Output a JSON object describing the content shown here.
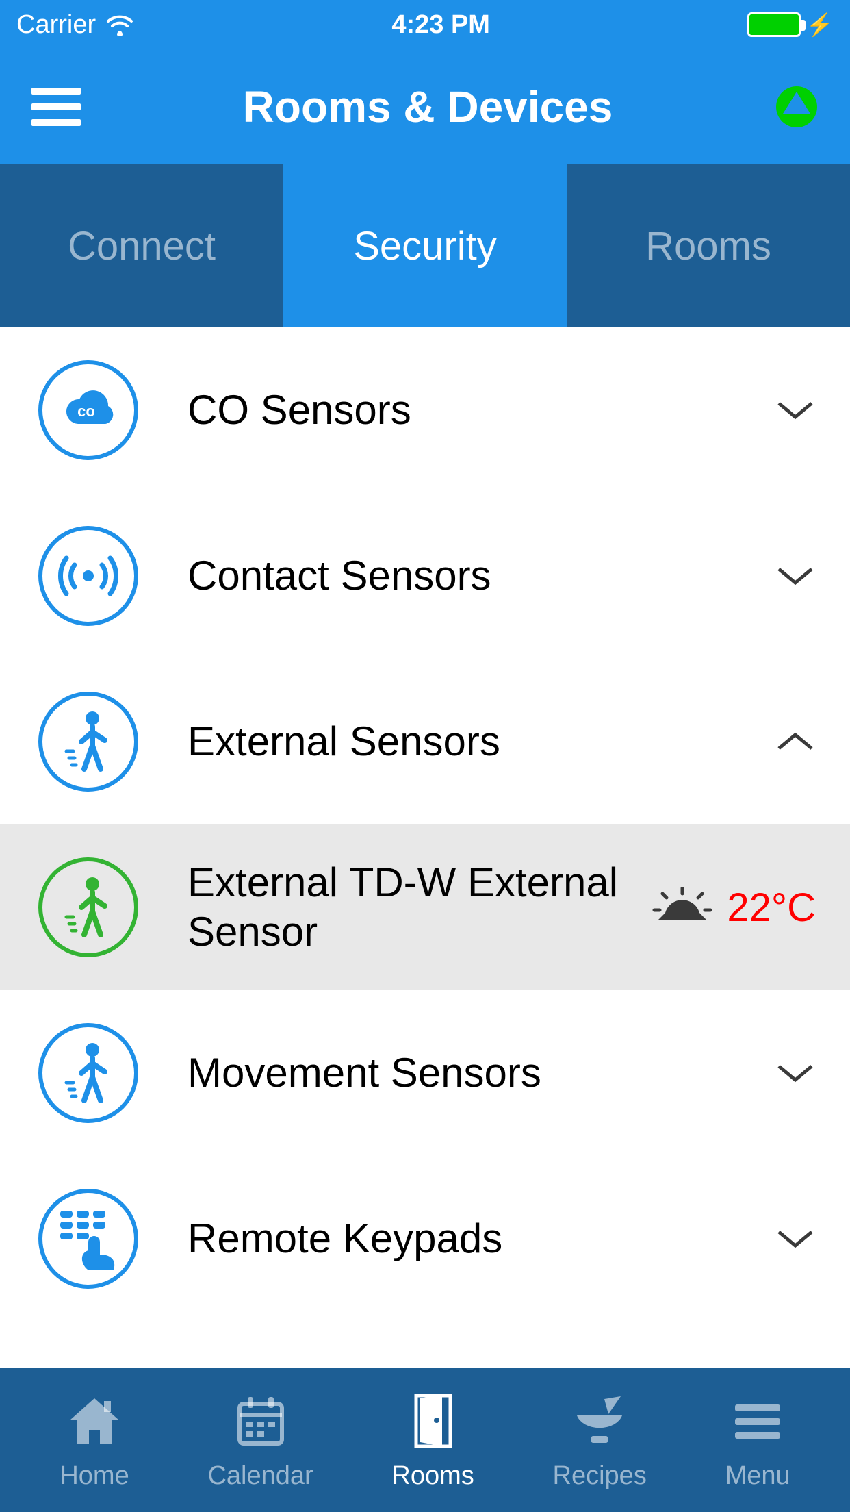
{
  "status": {
    "carrier": "Carrier",
    "time": "4:23 PM"
  },
  "header": {
    "title": "Rooms & Devices"
  },
  "tabs": {
    "items": [
      "Connect",
      "Security",
      "Rooms"
    ],
    "active_index": 1
  },
  "list": {
    "items": [
      {
        "icon": "co-cloud-icon",
        "label": "CO Sensors",
        "expanded": false
      },
      {
        "icon": "contact-radio-icon",
        "label": "Contact Sensors",
        "expanded": false
      },
      {
        "icon": "motion-person-icon",
        "label": "External Sensors",
        "expanded": true
      },
      {
        "icon": "motion-person-icon",
        "icon_color": "green",
        "label": "External TD-W External Sensor",
        "sub": true,
        "value": "22°C",
        "value_icon": "weather-icon"
      },
      {
        "icon": "motion-person-icon",
        "label": "Movement Sensors",
        "expanded": false
      },
      {
        "icon": "keypad-touch-icon",
        "label": "Remote Keypads",
        "expanded": false
      }
    ]
  },
  "bottom_nav": {
    "items": [
      {
        "icon": "home-icon",
        "label": "Home"
      },
      {
        "icon": "calendar-icon",
        "label": "Calendar"
      },
      {
        "icon": "door-icon",
        "label": "Rooms"
      },
      {
        "icon": "mortar-icon",
        "label": "Recipes"
      },
      {
        "icon": "menu-lines-icon",
        "label": "Menu"
      }
    ],
    "active_index": 2
  },
  "colors": {
    "primary": "#1e90e8",
    "dark": "#1d5e94",
    "accent_green": "#00d000",
    "temp_red": "#ff0000"
  }
}
